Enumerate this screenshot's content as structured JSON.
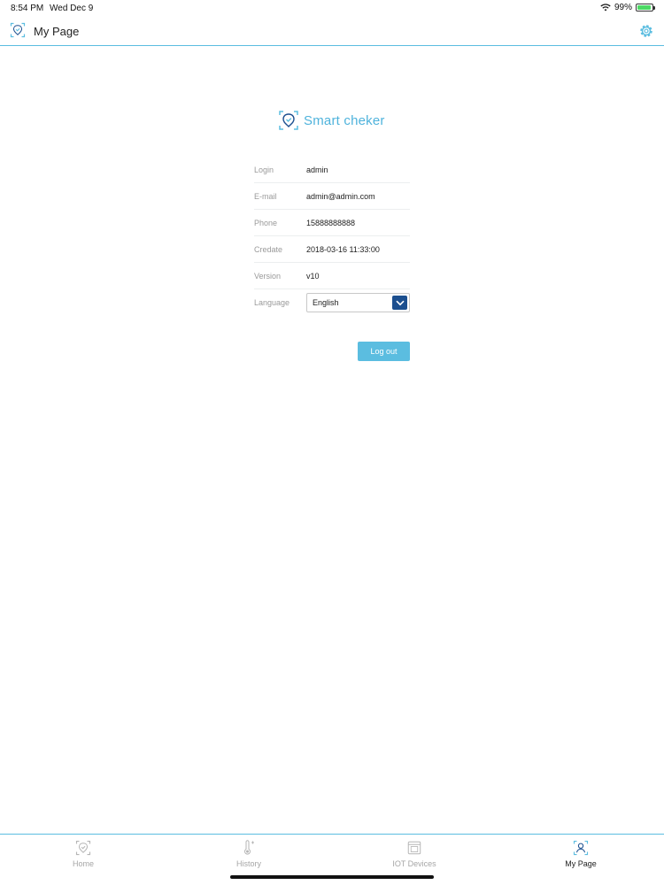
{
  "status_bar": {
    "time": "8:54 PM",
    "date": "Wed Dec 9",
    "battery": "99%"
  },
  "header": {
    "title": "My Page"
  },
  "brand": {
    "name": "Smart cheker"
  },
  "profile": {
    "rows": [
      {
        "label": "Login",
        "value": "admin"
      },
      {
        "label": "E-mail",
        "value": "admin@admin.com"
      },
      {
        "label": "Phone",
        "value": "15888888888"
      },
      {
        "label": "Credate",
        "value": "2018-03-16 11:33:00"
      },
      {
        "label": "Version",
        "value": "v10"
      }
    ],
    "language": {
      "label": "Language",
      "selected": "English"
    },
    "logout_label": "Log out"
  },
  "tabs": [
    {
      "label": "Home",
      "icon": "home-face-icon",
      "active": false
    },
    {
      "label": "History",
      "icon": "thermometer-icon",
      "active": false
    },
    {
      "label": "IOT Devices",
      "icon": "device-icon",
      "active": false
    },
    {
      "label": "My Page",
      "icon": "user-scan-icon",
      "active": true
    }
  ],
  "colors": {
    "accent": "#5bbde0",
    "select_arrow": "#1c4f8f",
    "inactive_tab": "#a6a6a6"
  }
}
